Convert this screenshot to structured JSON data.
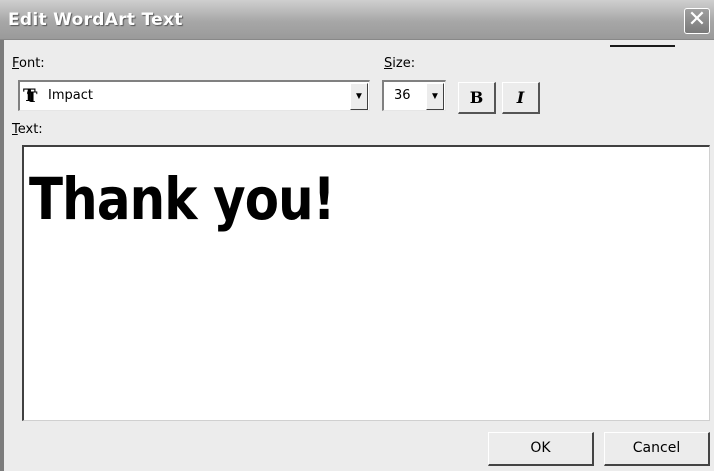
{
  "window": {
    "title": "Edit WordArt Text",
    "close_glyph": "✕"
  },
  "font": {
    "label_accel": "F",
    "label_rest": "ont:",
    "value": "Impact",
    "icon": "truetype-font-icon"
  },
  "size": {
    "label_accel": "S",
    "label_rest": "ize:",
    "value": "36"
  },
  "format": {
    "bold_label": "B",
    "italic_label": "I"
  },
  "text": {
    "label_accel": "T",
    "label_rest": "ext:",
    "value": "Thank you!"
  },
  "buttons": {
    "ok": "OK",
    "cancel": "Cancel"
  },
  "colors": {
    "titlebar": "#9a9a9a",
    "dialog_bg": "#ececec"
  }
}
